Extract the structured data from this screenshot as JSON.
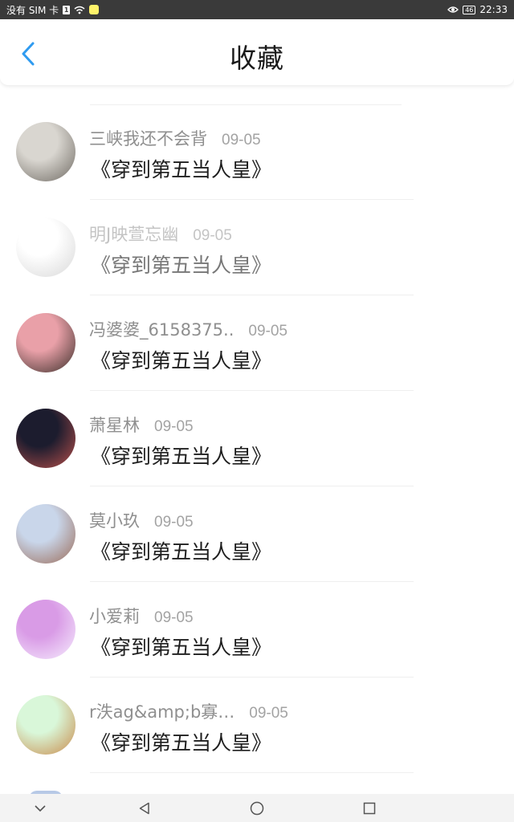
{
  "status_bar": {
    "carrier": "没有 SIM 卡",
    "sim_label": "1",
    "battery": "46",
    "time": "22:33"
  },
  "header": {
    "title": "收藏"
  },
  "accent_color": "#2f9bf0",
  "favorites": [
    {
      "user": "三峡我还不会背",
      "date": "09-05",
      "title": "《穿到第五当人皇》",
      "avatar_colors": [
        "#d9d6d0",
        "#6f6a63"
      ]
    },
    {
      "user": "明J映萱忘幽",
      "date": "09-05",
      "title": "《穿到第五当人皇》",
      "avatar_colors": [
        "#ffffff",
        "#d8d8d8"
      ]
    },
    {
      "user": "冯婆婆_6158375..",
      "date": "09-05",
      "title": "《穿到第五当人皇》",
      "avatar_colors": [
        "#e9a0a8",
        "#3b2f2a"
      ]
    },
    {
      "user": "萧星林",
      "date": "09-05",
      "title": "《穿到第五当人皇》",
      "avatar_colors": [
        "#1c1c2e",
        "#b9504b"
      ]
    },
    {
      "user": "莫小玖",
      "date": "09-05",
      "title": "《穿到第五当人皇》",
      "avatar_colors": [
        "#c9d6ea",
        "#9a6b58"
      ]
    },
    {
      "user": "小爱莉",
      "date": "09-05",
      "title": "《穿到第五当人皇》",
      "avatar_colors": [
        "#d99be6",
        "#f6eefe"
      ]
    },
    {
      "user": "r泆ag&amp;b寡…",
      "date": "09-05",
      "title": "《穿到第五当人皇》",
      "avatar_colors": [
        "#d9f7d9",
        "#c98a4a"
      ]
    }
  ]
}
